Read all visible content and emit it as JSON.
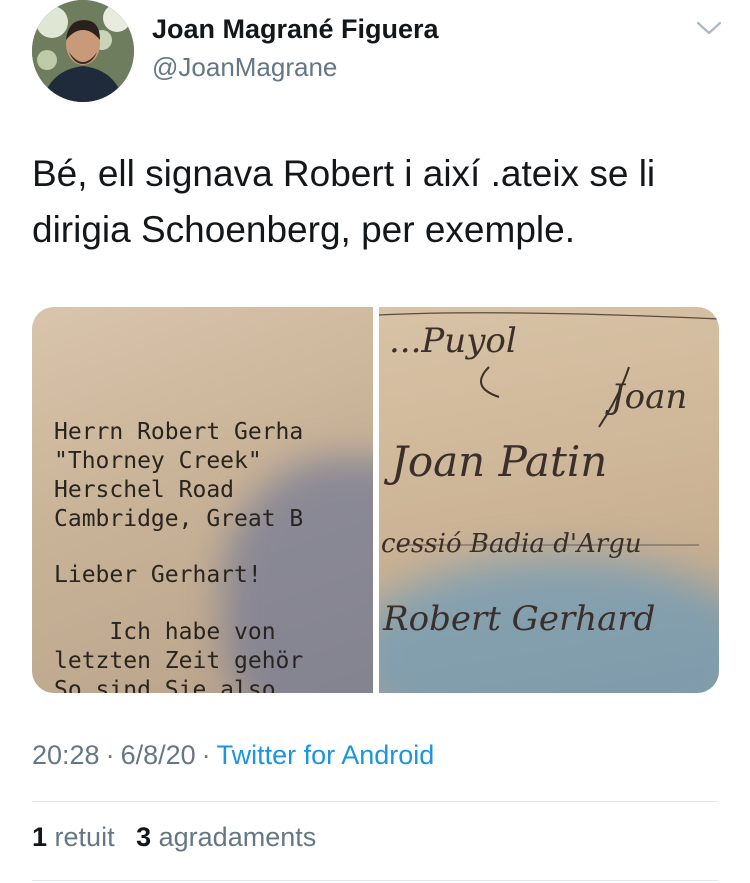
{
  "user": {
    "display_name": "Joan Magrané Figuera",
    "handle": "@JoanMagrane",
    "avatar_icon": "avatar-photo",
    "menu_icon": "chevron-down-icon"
  },
  "tweet": {
    "text": "Bé, ell signava Robert i així .ateix se li dirigia Schoenberg, per exemple."
  },
  "media": {
    "left_photo": {
      "lines": [
        "Herrn Robert Gerha",
        "\"Thorney Creek\"",
        "Herschel Road",
        "Cambridge, Great B",
        "Lieber Gerhart!",
        "    Ich habe von",
        "letzten Zeit gehör",
        "So sind Sie also "
      ]
    },
    "right_photo": {
      "lines": [
        "...Puyol",
        "Joan",
        "Joan Patin",
        "cessió Badia d'Argu",
        "Robert Gerhard"
      ]
    }
  },
  "meta": {
    "time": "20:28",
    "date": "6/8/20",
    "separator": "·",
    "source": "Twitter for Android"
  },
  "stats": {
    "retweets_count": "1",
    "retweets_label": "retuit",
    "likes_count": "3",
    "likes_label": "agradaments"
  },
  "colors": {
    "text": "#14171a",
    "secondary": "#657786",
    "link": "#1b95e0",
    "divider": "#e1e8ed"
  }
}
